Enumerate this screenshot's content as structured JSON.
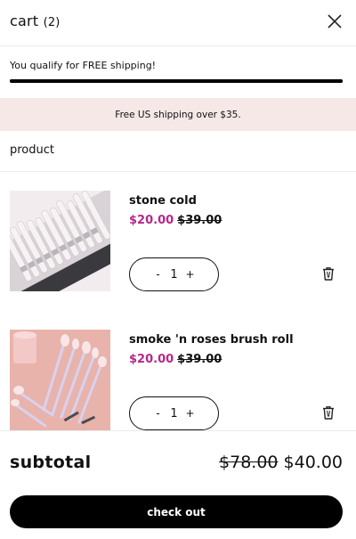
{
  "header": {
    "title": "cart",
    "count": "(2)"
  },
  "shipping": {
    "message": "You qualify for FREE shipping!",
    "progress": 1.0,
    "banner": "Free US shipping over $35."
  },
  "section_label": "product",
  "items": [
    {
      "name": "stone cold",
      "price": "$20.00",
      "original_price": "$39.00",
      "quantity": "1",
      "minus": "-",
      "plus": "+"
    },
    {
      "name": "smoke 'n roses brush roll",
      "price": "$20.00",
      "original_price": "$39.00",
      "quantity": "1",
      "minus": "-",
      "plus": "+"
    }
  ],
  "subtotal": {
    "label": "subtotal",
    "original": "$78.00",
    "current": "$40.00"
  },
  "checkout_label": "check out",
  "colors": {
    "sale_price": "#b5288a",
    "banner_bg": "#f7e8e8",
    "primary": "#000000"
  },
  "icons": [
    "close-icon",
    "trash-icon"
  ]
}
